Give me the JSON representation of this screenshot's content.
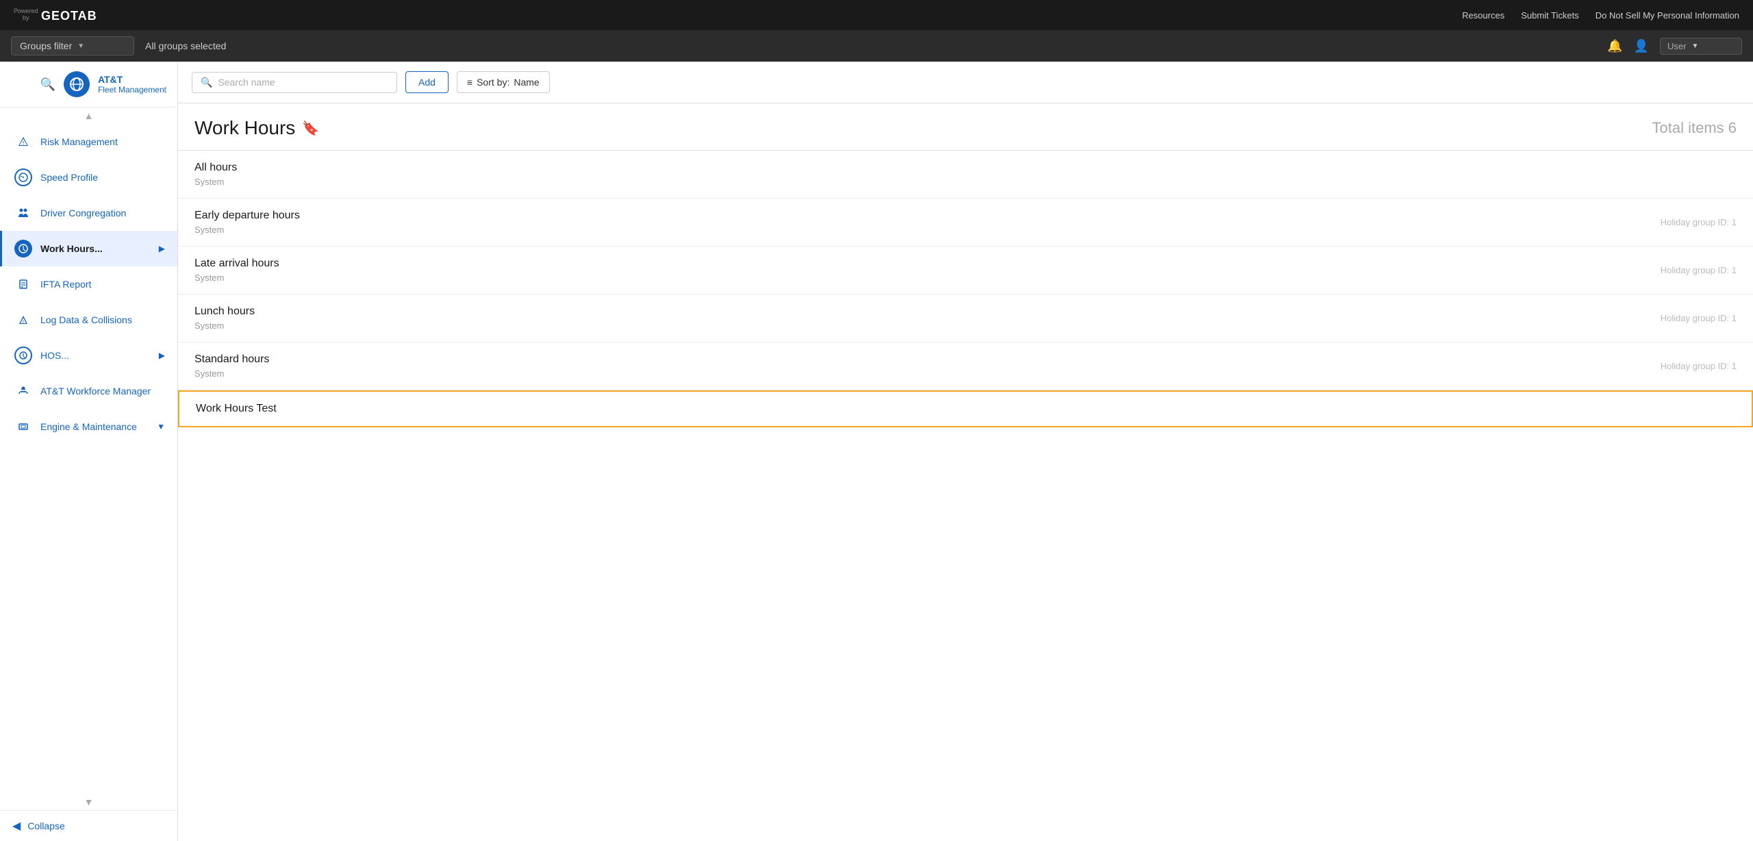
{
  "topbar": {
    "powered_by": "Powered\nby",
    "brand": "GEOTAB",
    "links": [
      "Resources",
      "Submit Tickets",
      "Do Not Sell My Personal Information"
    ]
  },
  "filterbar": {
    "groups_filter_label": "Groups filter",
    "groups_selected": "All groups selected"
  },
  "sidebar": {
    "company_name": "AT&T",
    "company_sub": "Fleet Management",
    "nav_items": [
      {
        "label": "Risk Management",
        "icon_type": "shield",
        "active": false
      },
      {
        "label": "Speed Profile",
        "icon_type": "speedometer",
        "active": false
      },
      {
        "label": "Driver Congregation",
        "icon_type": "group",
        "active": false
      },
      {
        "label": "Work Hours...",
        "icon_type": "clock",
        "active": true,
        "has_arrow": true
      },
      {
        "label": "IFTA Report",
        "icon_type": "document",
        "active": false
      },
      {
        "label": "Log Data & Collisions",
        "icon_type": "warning",
        "active": false
      },
      {
        "label": "HOS...",
        "icon_type": "timer",
        "active": false,
        "has_arrow": true
      }
    ],
    "sections": [
      {
        "label": "AT&T Workforce Manager",
        "icon_type": "puzzle"
      },
      {
        "label": "Engine & Maintenance",
        "icon_type": "film",
        "has_arrow": true
      }
    ],
    "collapse_label": "Collapse"
  },
  "toolbar": {
    "search_placeholder": "Search name",
    "add_label": "Add",
    "sort_label": "Sort by:",
    "sort_value": "Name"
  },
  "page": {
    "title": "Work Hours",
    "total_label": "Total items 6",
    "items": [
      {
        "name": "All hours",
        "sub": "System",
        "meta": ""
      },
      {
        "name": "Early departure hours",
        "sub": "System",
        "meta": "Holiday group ID: 1"
      },
      {
        "name": "Late arrival hours",
        "sub": "System",
        "meta": "Holiday group ID: 1"
      },
      {
        "name": "Lunch hours",
        "sub": "System",
        "meta": "Holiday group ID: 1"
      },
      {
        "name": "Standard hours",
        "sub": "System",
        "meta": "Holiday group ID: 1"
      },
      {
        "name": "Work Hours Test",
        "sub": "",
        "meta": "",
        "highlighted": true
      }
    ]
  }
}
